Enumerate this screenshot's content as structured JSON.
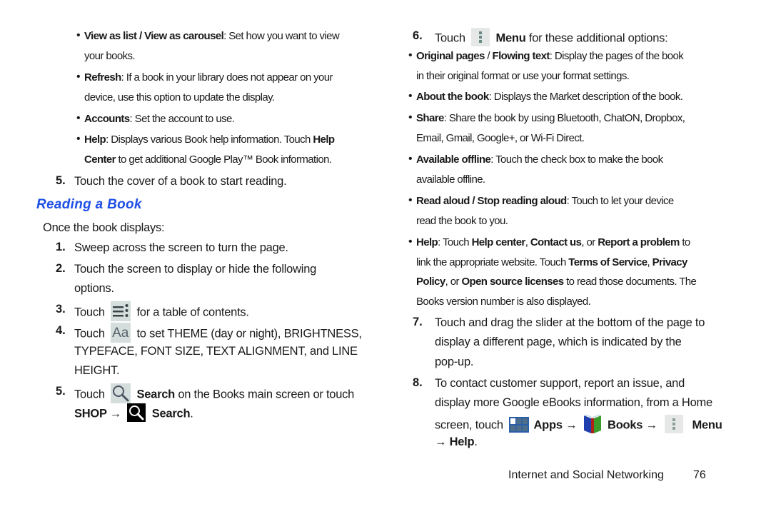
{
  "left_column": {
    "bullets_top": [
      {
        "lines": [
          [
            {
              "b": "View as list / View as carousel"
            },
            {
              "t": ": Set how you want to view"
            }
          ],
          [
            {
              "t": "your books."
            }
          ]
        ]
      },
      {
        "lines": [
          [
            {
              "b": "Refresh"
            },
            {
              "t": ": If a book in your library does not appear on your"
            }
          ],
          [
            {
              "t": "device, use this option to update the display."
            }
          ]
        ]
      },
      {
        "lines": [
          [
            {
              "b": "Accounts"
            },
            {
              "t": ": Set the account to use."
            }
          ]
        ]
      },
      {
        "lines": [
          [
            {
              "b": "Help"
            },
            {
              "t": ": Displays various Book help information. Touch "
            },
            {
              "b": "Help"
            }
          ],
          [
            {
              "b": "Center"
            },
            {
              "t": " to get additional Google Play™ Book information."
            }
          ]
        ]
      }
    ],
    "step5_top": {
      "number": "5.",
      "text": "Touch the cover of a book to start reading."
    },
    "section_heading": "Reading a Book",
    "intro": "Once the book displays:",
    "steps": [
      {
        "number": "1.",
        "text": "Sweep across the screen to turn the page."
      },
      {
        "number": "2.",
        "line1": "Touch the screen to display or hide the following",
        "line2": "options."
      },
      {
        "number": "3.",
        "pre": "Touch",
        "icon": "table-of-contents-icon",
        "post": "for a table of contents."
      },
      {
        "number": "4.",
        "pre": "Touch",
        "icon": "text-settings-icon",
        "icon_glyph": "Aa",
        "post": "to set THEME (day or night), BRIGHTNESS,",
        "line2": "TYPEFACE, FONT SIZE, TEXT ALIGNMENT, and LINE",
        "line3": "HEIGHT."
      },
      {
        "number": "5.",
        "pre": "Touch",
        "icon": "search-icon",
        "bold": "Search",
        "post": " on the Books main screen or touch",
        "line2_bold1": "SHOP →",
        "line2_icon": "search-black-icon",
        "line2_bold2": "Search",
        "line2_end": "."
      }
    ]
  },
  "right_column": {
    "step6": {
      "number": "6.",
      "pre": "Touch",
      "icon": "menu-icon",
      "bold": "Menu",
      "post": " for these additional options:"
    },
    "bullets": [
      {
        "lines": [
          [
            {
              "b": "Original pages"
            },
            {
              "t": " / "
            },
            {
              "b": "Flowing text"
            },
            {
              "t": ": Display the pages of the book"
            }
          ],
          [
            {
              "t": "in their original format or use your format settings."
            }
          ]
        ]
      },
      {
        "lines": [
          [
            {
              "b": "About the book"
            },
            {
              "t": ": Displays the Market description of the book."
            }
          ]
        ]
      },
      {
        "lines": [
          [
            {
              "b": "Share"
            },
            {
              "t": ": Share the book by using Bluetooth, ChatON, Dropbox,"
            }
          ],
          [
            {
              "t": "Email, Gmail, Google+, or Wi-Fi Direct."
            }
          ]
        ]
      },
      {
        "lines": [
          [
            {
              "b": "Available offline"
            },
            {
              "t": ": Touch the check box to make the book"
            }
          ],
          [
            {
              "t": "available offline."
            }
          ]
        ]
      },
      {
        "lines": [
          [
            {
              "b": "Read aloud / Stop reading aloud"
            },
            {
              "t": ": Touch to let your device"
            }
          ],
          [
            {
              "t": "read the book to you."
            }
          ]
        ]
      },
      {
        "lines": [
          [
            {
              "b": "Help"
            },
            {
              "t": ": Touch "
            },
            {
              "b": "Help center"
            },
            {
              "t": ", "
            },
            {
              "b": "Contact us"
            },
            {
              "t": ", or "
            },
            {
              "b": "Report a problem"
            },
            {
              "t": " to"
            }
          ],
          [
            {
              "t": "link the appropriate website. Touch "
            },
            {
              "b": "Terms of Service"
            },
            {
              "t": ", "
            },
            {
              "b": "Privacy"
            }
          ],
          [
            {
              "b": "Policy"
            },
            {
              "t": ", or "
            },
            {
              "b": "Open source licenses"
            },
            {
              "t": " to read those documents. The"
            }
          ],
          [
            {
              "t": "Books version number is also displayed."
            }
          ]
        ]
      }
    ],
    "step7": {
      "number": "7.",
      "line1": "Touch and drag the slider at the bottom of the page to",
      "line2": "display a different page, which is indicated by the",
      "line3": "pop-up."
    },
    "step8": {
      "number": "8.",
      "line1": "To contact customer support, report an issue, and",
      "line2": "display more Google eBooks information, from a Home",
      "line3_pre": "screen, touch",
      "apps": "Apps →",
      "books": "Books →",
      "menu": "Menu",
      "line4_bold": "→ Help",
      "line4_end": "."
    }
  },
  "footer": {
    "section": "Internet and Social Networking",
    "page_number": "76"
  }
}
